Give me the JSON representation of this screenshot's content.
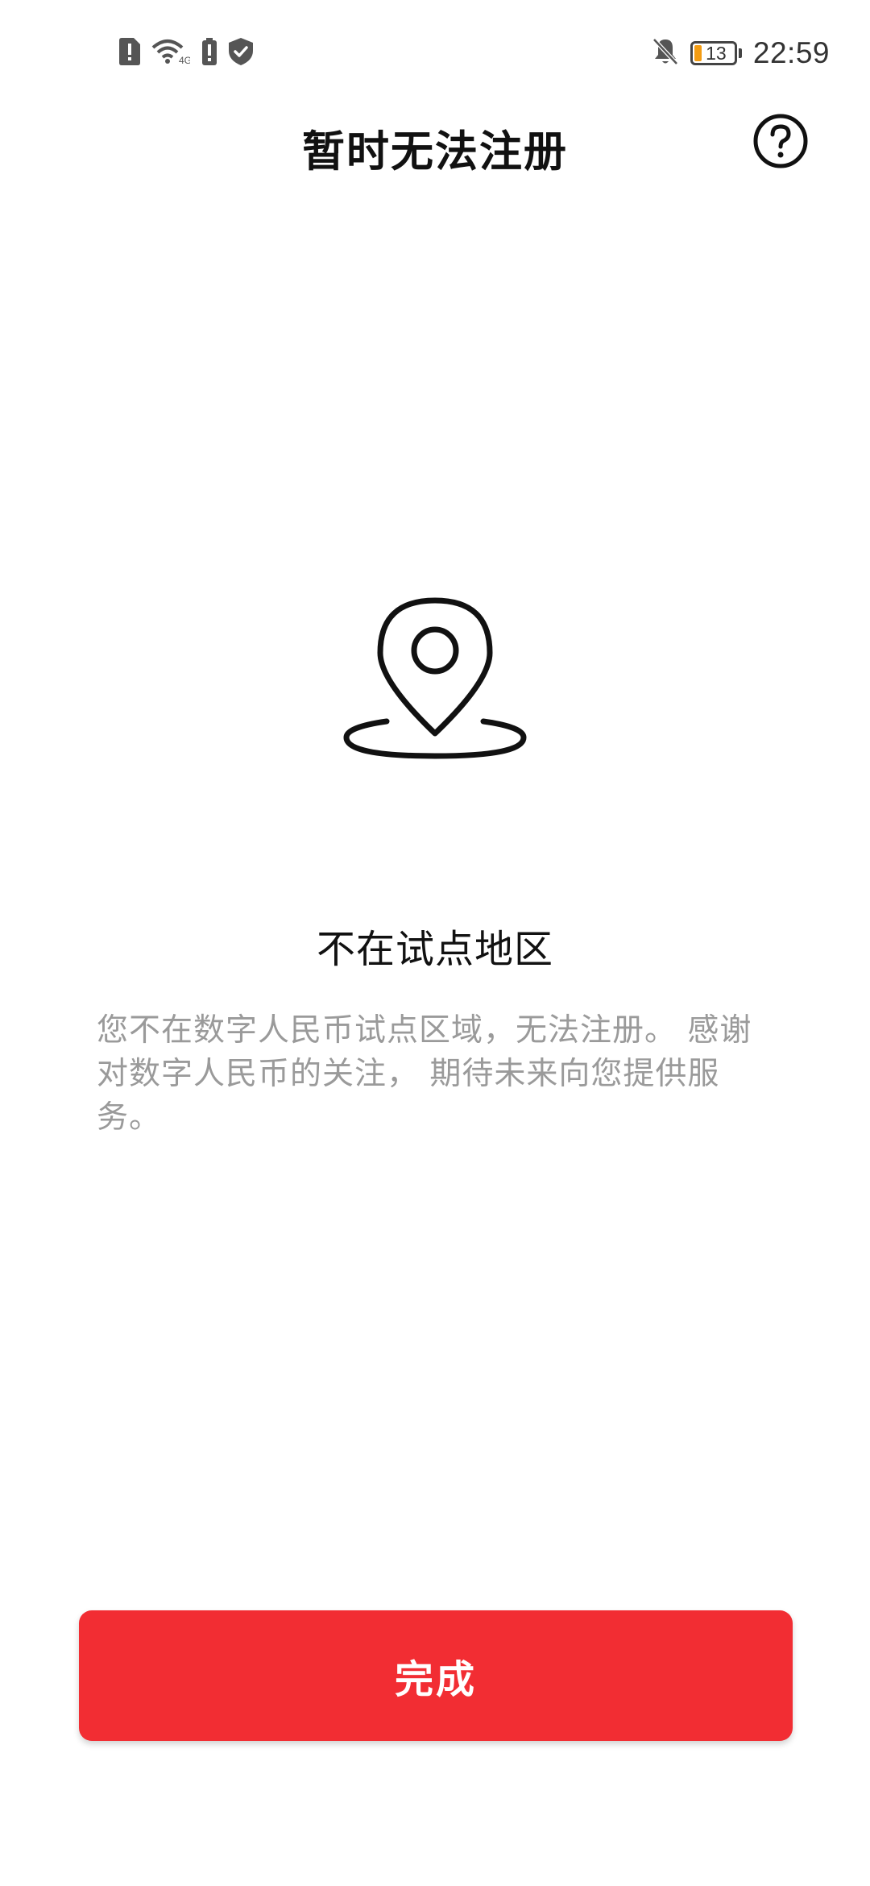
{
  "status_bar": {
    "time": "22:59",
    "battery_level": "13",
    "battery_color": "#f39c12",
    "left_icons": [
      "sim-alert-icon",
      "wifi-4g-icon",
      "battery-alert-icon",
      "shield-check-icon"
    ],
    "right_icons": [
      "bell-off-icon",
      "battery-icon"
    ]
  },
  "header": {
    "title": "暂时无法注册",
    "help_icon": "question-circle-icon"
  },
  "main": {
    "illustration_icon": "location-pin-icon",
    "region_title": "不在试点地区",
    "description": "您不在数字人民币试点区域，无法注册。 感谢对数字人民币的关注， 期待未来向您提供服务。"
  },
  "footer": {
    "done_label": "完成",
    "button_color": "#f22d33"
  }
}
